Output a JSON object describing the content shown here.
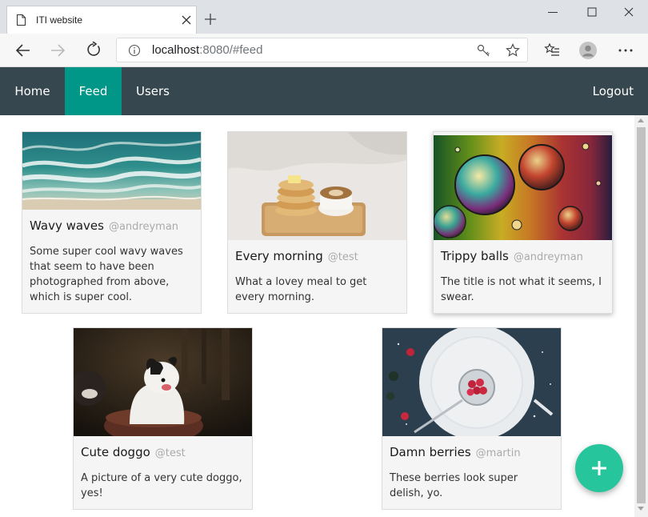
{
  "browser": {
    "tab_title": "ITI website",
    "url_host": "localhost",
    "url_rest": ":8080/#feed"
  },
  "nav": {
    "home": "Home",
    "feed": "Feed",
    "users": "Users",
    "logout": "Logout",
    "active": "Feed"
  },
  "colors": {
    "navbar": "#37474f",
    "active_tab": "#009688",
    "fab": "#26c59b"
  },
  "cards": [
    {
      "title": "Wavy waves",
      "user": "@andreyman",
      "text": "Some super cool wavy waves that seem to have been photographed from above, which is super cool.",
      "image": "aerial-waves-photo"
    },
    {
      "title": "Every morning",
      "user": "@test",
      "text": "What a lovey meal to get every morning.",
      "image": "pancakes-coffee-photo"
    },
    {
      "title": "Trippy balls",
      "user": "@andreyman",
      "text": "The title is not what it seems, I swear.",
      "image": "oil-bubbles-photo"
    },
    {
      "title": "Cute doggo",
      "user": "@test",
      "text": "A picture of a very cute doggo, yes!",
      "image": "puppy-photo"
    },
    {
      "title": "Damn berries",
      "user": "@martin",
      "text": "These berries look super delish, yo.",
      "image": "raspberries-plate-photo"
    }
  ],
  "fab": {
    "icon": "plus-icon"
  }
}
